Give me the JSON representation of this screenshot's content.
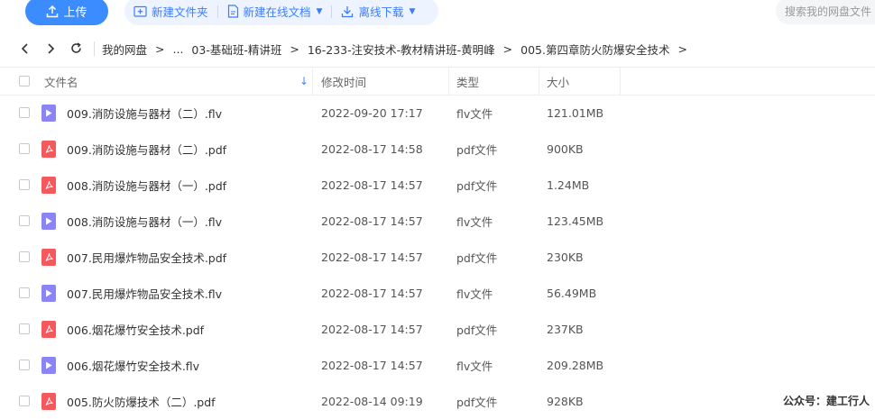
{
  "toolbar": {
    "upload_label": "上传",
    "new_folder_label": "新建文件夹",
    "new_online_doc_label": "新建在线文档",
    "offline_download_label": "离线下载",
    "search_placeholder": "搜索我的网盘文件"
  },
  "nav": {
    "crumbs": [
      "我的网盘",
      "...",
      "03-基础班-精讲班",
      "16-233-注安技术-教材精讲班-黄明峰",
      "005.第四章防火防爆安全技术"
    ],
    "separator": ">"
  },
  "table": {
    "headers": {
      "name": "文件名",
      "modified": "修改时间",
      "type": "类型",
      "size": "大小"
    },
    "rows": [
      {
        "icon": "video-file-icon",
        "name": "009.消防设施与器材（二）.flv",
        "modified": "2022-09-20 17:17",
        "type": "flv文件",
        "size": "121.01MB"
      },
      {
        "icon": "pdf-file-icon",
        "name": "009.消防设施与器材（二）.pdf",
        "modified": "2022-08-17 14:58",
        "type": "pdf文件",
        "size": "900KB"
      },
      {
        "icon": "pdf-file-icon",
        "name": "008.消防设施与器材（一）.pdf",
        "modified": "2022-08-17 14:57",
        "type": "pdf文件",
        "size": "1.24MB"
      },
      {
        "icon": "video-file-icon",
        "name": "008.消防设施与器材（一）.flv",
        "modified": "2022-08-17 14:57",
        "type": "flv文件",
        "size": "123.45MB"
      },
      {
        "icon": "pdf-file-icon",
        "name": "007.民用爆炸物品安全技术.pdf",
        "modified": "2022-08-17 14:57",
        "type": "pdf文件",
        "size": "230KB"
      },
      {
        "icon": "video-file-icon",
        "name": "007.民用爆炸物品安全技术.flv",
        "modified": "2022-08-17 14:57",
        "type": "flv文件",
        "size": "56.49MB"
      },
      {
        "icon": "pdf-file-icon",
        "name": "006.烟花爆竹安全技术.pdf",
        "modified": "2022-08-17 14:57",
        "type": "pdf文件",
        "size": "237KB"
      },
      {
        "icon": "video-file-icon",
        "name": "006.烟花爆竹安全技术.flv",
        "modified": "2022-08-17 14:57",
        "type": "flv文件",
        "size": "209.28MB"
      },
      {
        "icon": "pdf-file-icon",
        "name": "005.防火防爆技术（二）.pdf",
        "modified": "2022-08-14 09:19",
        "type": "pdf文件",
        "size": "928KB"
      }
    ]
  },
  "watermark": "公众号：建工行人",
  "colors": {
    "accent": "#3b8cff",
    "video_icon": "#8a84f4",
    "pdf_icon": "#f4595c"
  }
}
